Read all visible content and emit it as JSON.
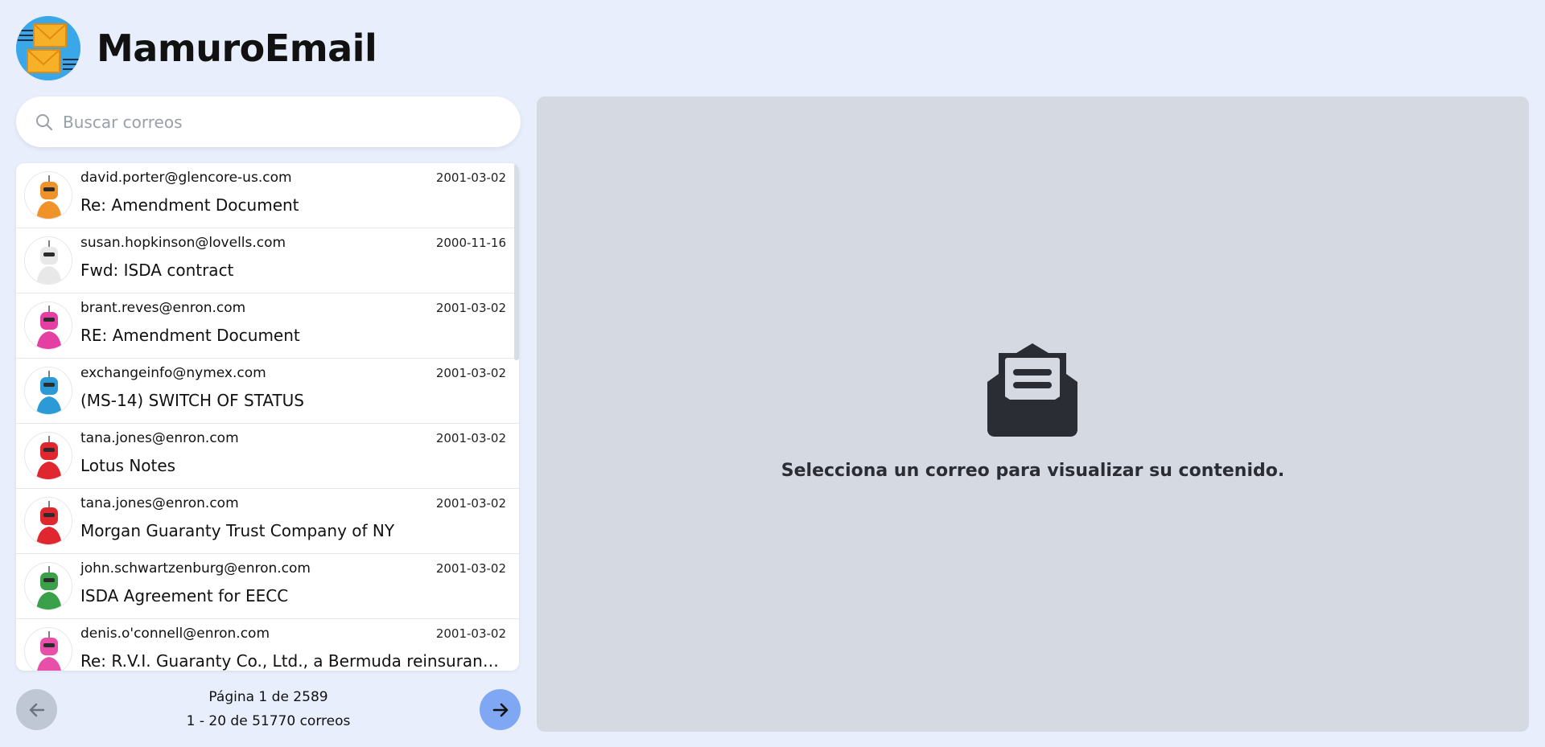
{
  "app": {
    "title": "MamuroEmail"
  },
  "search": {
    "placeholder": "Buscar correos",
    "value": ""
  },
  "emails": [
    {
      "sender": "david.porter@glencore-us.com",
      "date": "2001-03-02",
      "subject": "Re: Amendment Document",
      "avatar_color": "#f0922a"
    },
    {
      "sender": "susan.hopkinson@lovells.com",
      "date": "2000-11-16",
      "subject": "Fwd: ISDA contract",
      "avatar_color": "#e8e8e8"
    },
    {
      "sender": "brant.reves@enron.com",
      "date": "2001-03-02",
      "subject": "RE: Amendment Document",
      "avatar_color": "#e53fa3"
    },
    {
      "sender": "exchangeinfo@nymex.com",
      "date": "2001-03-02",
      "subject": "(MS-14) SWITCH OF STATUS",
      "avatar_color": "#2b9ad6"
    },
    {
      "sender": "tana.jones@enron.com",
      "date": "2001-03-02",
      "subject": "Lotus Notes",
      "avatar_color": "#e0262e"
    },
    {
      "sender": "tana.jones@enron.com",
      "date": "2001-03-02",
      "subject": "Morgan Guaranty Trust Company of NY",
      "avatar_color": "#e0262e"
    },
    {
      "sender": "john.schwartzenburg@enron.com",
      "date": "2001-03-02",
      "subject": "ISDA Agreement for EECC",
      "avatar_color": "#3aa04a"
    },
    {
      "sender": "denis.o'connell@enron.com",
      "date": "2001-03-02",
      "subject": "Re: R.V.I. Guaranty Co., Ltd., a Bermuda reinsurance company",
      "avatar_color": "#e84fa8"
    }
  ],
  "pagination": {
    "page_text": "Página 1 de 2589",
    "count_text": "1 - 20 de 51770 correos"
  },
  "viewer": {
    "empty_message": "Selecciona un correo para visualizar su contenido."
  },
  "colors": {
    "background": "#e8eefc",
    "accent": "#7fa7f4",
    "viewer_bg": "#d5d9e1"
  }
}
